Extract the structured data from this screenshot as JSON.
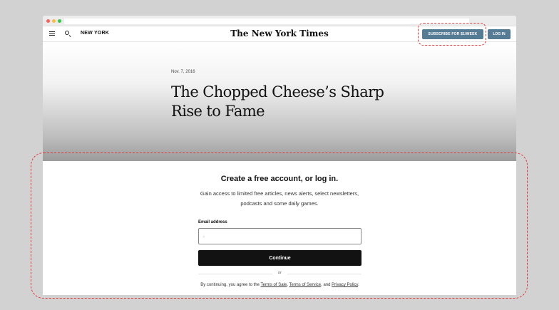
{
  "browser": {
    "dots": [
      "#fc605c",
      "#fdbc40",
      "#34c84a"
    ]
  },
  "header": {
    "section": "NEW YORK",
    "logo": "The New York Times",
    "subscribe_label": "SUBSCRIBE FOR $1/WEEK",
    "login_label": "LOG IN",
    "accent": "#567b95"
  },
  "article": {
    "date": "Nov. 7, 2016",
    "headline": "The Chopped Cheese’s Sharp Rise to Fame"
  },
  "modal": {
    "title": "Create a free account, or log in.",
    "description": "Gain access to limited free articles, news alerts, select newsletters, podcasts and some daily games.",
    "email_label": "Email address",
    "email_value": ".",
    "continue_label": "Continue",
    "or_label": "or",
    "terms_prefix": "By continuing, you agree to the ",
    "terms_sale": "Terms of Sale",
    "terms_sep": ", ",
    "terms_service": "Terms of Service",
    "terms_and": ", and ",
    "privacy": "Privacy Policy",
    "terms_suffix": "."
  },
  "annotations": {
    "color": "#e03838"
  }
}
